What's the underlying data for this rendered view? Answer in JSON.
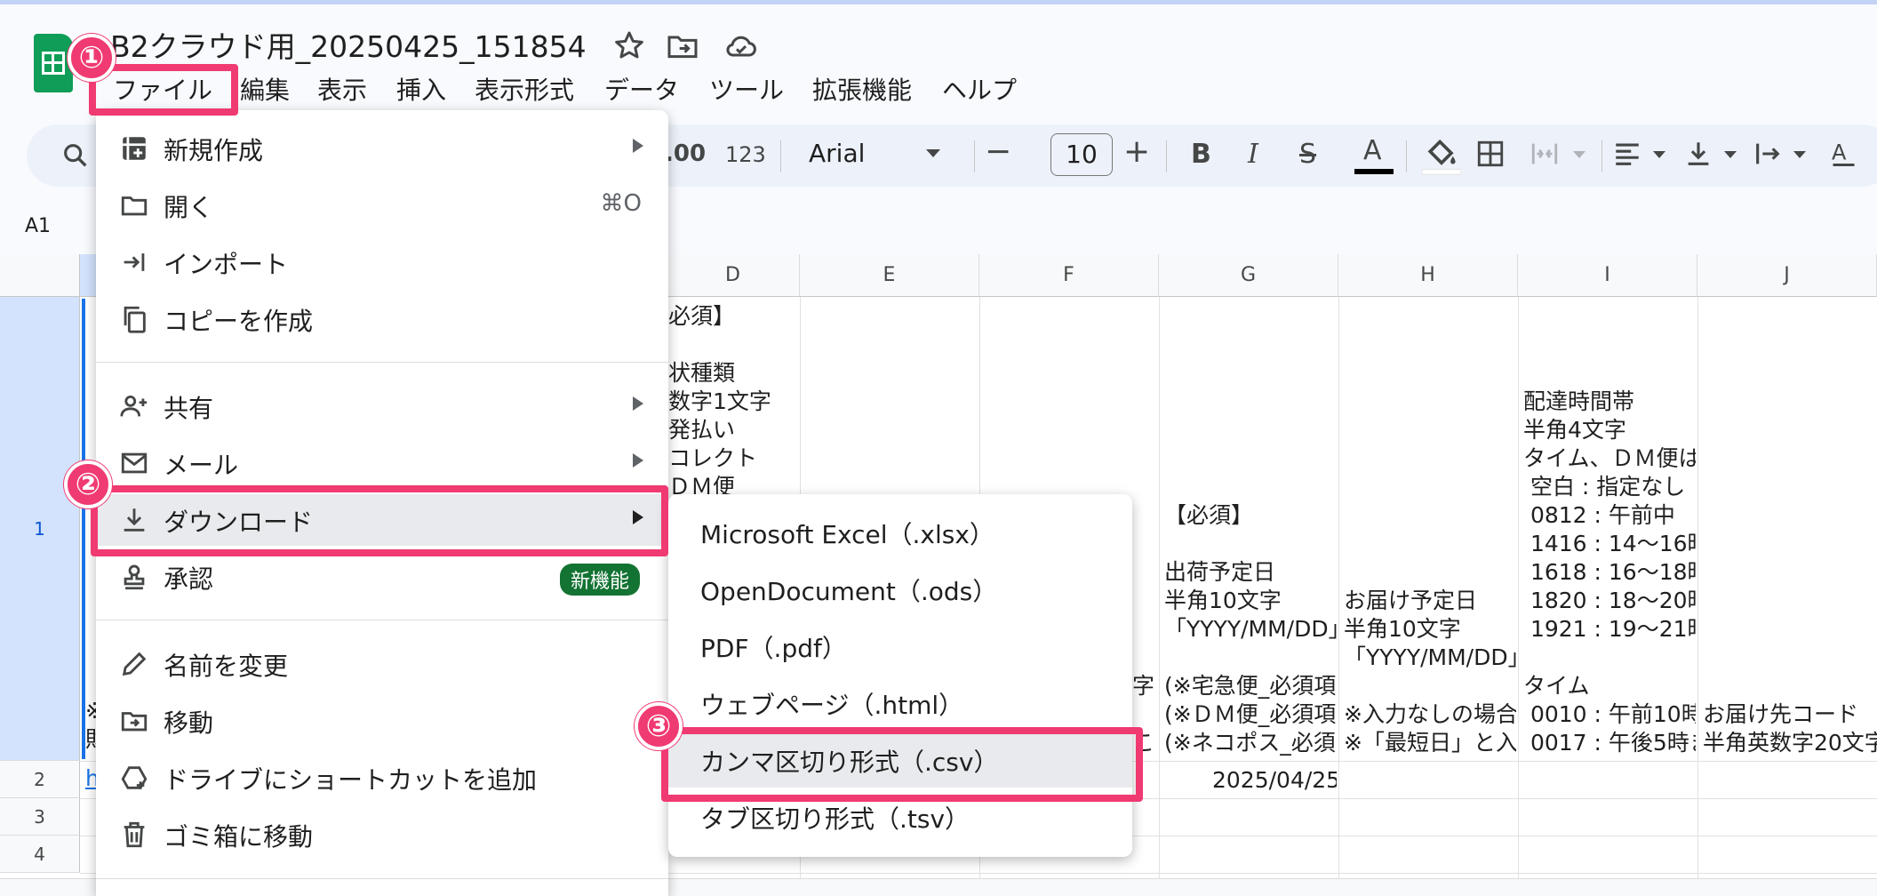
{
  "doc": {
    "title": "B2クラウド用_20250425_151854",
    "icons": [
      "star-icon",
      "move-to-folder-icon",
      "cloud-status-icon"
    ]
  },
  "menubar": {
    "items": [
      "ファイル",
      "編集",
      "表示",
      "挿入",
      "表示形式",
      "データ",
      "ツール",
      "拡張機能",
      "ヘルプ"
    ]
  },
  "toolbar": {
    "decimal_label": ".00",
    "format_label": "123",
    "font": "Arial",
    "font_size": "10",
    "minus": "−",
    "plus": "+"
  },
  "namebox": "A1",
  "columns": [
    "D",
    "E",
    "F",
    "G",
    "H",
    "I",
    "J"
  ],
  "rows": [
    "1",
    "2",
    "3",
    "4"
  ],
  "cells": {
    "d1": "必須】\n\n状種類\n数字1文字\n発払い\nコレクト\nＤＭ便",
    "f1_a": "字",
    "f1_b": "こ",
    "g1": "【必須】\n\n出荷予定日\n半角10文字\n「YYYY/MM/DD」\n\n(※宅急便_必須項\n(※ＤＭ便_必須項\n(※ネコポス_必須",
    "h1": "お届け予定日\n半角10文字\n「YYYY/MM/DD」\n\n※入力なしの場合\n※「最短日」と入",
    "i1": "配達時間帯\n半角4文字\nタイム、ＤＭ便は\n 空白 : 指定なし\n 0812 : 午前中\n 1416 : 14～16時\n 1618 : 16～18時\n 1820 : 18～20時\n 1921 : 19～21時\n\nタイム\n 0010 : 午前10時\n 0017 : 午後5時ま",
    "j1": "お届け先コード\n半角英数字20文字",
    "a1": "※\n財",
    "g2": "2025/04/25",
    "a2": "h"
  },
  "file_menu": {
    "items": [
      {
        "label": "新規作成",
        "icon": "new-sheet-icon",
        "submenu": true
      },
      {
        "label": "開く",
        "icon": "folder-open-icon",
        "shortcut": "⌘O"
      },
      {
        "label": "インポート",
        "icon": "import-icon"
      },
      {
        "label": "コピーを作成",
        "icon": "copy-icon"
      },
      {
        "label": "共有",
        "icon": "share-person-icon",
        "submenu": true
      },
      {
        "label": "メール",
        "icon": "mail-icon",
        "submenu": true
      },
      {
        "label": "ダウンロード",
        "icon": "download-icon",
        "submenu": true
      },
      {
        "label": "承認",
        "icon": "approval-stamp-icon",
        "badge": "新機能"
      },
      {
        "label": "名前を変更",
        "icon": "pencil-icon"
      },
      {
        "label": "移動",
        "icon": "move-folder-icon"
      },
      {
        "label": "ドライブにショートカットを追加",
        "icon": "drive-shortcut-icon"
      },
      {
        "label": "ゴミ箱に移動",
        "icon": "trash-icon"
      }
    ]
  },
  "download_menu": {
    "items": [
      "Microsoft Excel（.xlsx）",
      "OpenDocument（.ods）",
      "PDF（.pdf）",
      "ウェブページ（.html）",
      "カンマ区切り形式（.csv）",
      "タブ区切り形式（.tsv）"
    ]
  },
  "annotations": {
    "step1": "①",
    "step2": "②",
    "step3": "③",
    "color": "#f03a72"
  }
}
